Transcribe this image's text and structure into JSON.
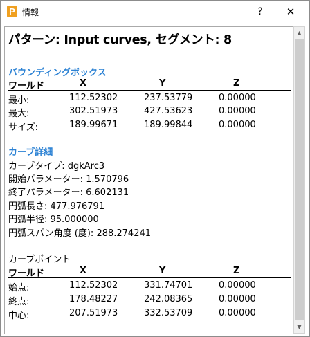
{
  "window": {
    "title": "情報",
    "icon_letter": "P",
    "help_label": "?",
    "close_label": "✕"
  },
  "heading": "パターン: Input curves, セグメント: 8",
  "bbox": {
    "section_title": "バウンディングボックス",
    "headers": [
      "ワールド",
      "X",
      "Y",
      "Z"
    ],
    "rows": [
      {
        "label": "最小:",
        "x": "112.52302",
        "y": "237.53779",
        "z": "0.00000"
      },
      {
        "label": "最大:",
        "x": "302.51973",
        "y": "427.53623",
        "z": "0.00000"
      },
      {
        "label": "サイズ:",
        "x": "189.99671",
        "y": "189.99844",
        "z": "0.00000"
      }
    ]
  },
  "curve": {
    "section_title": "カーブ詳細",
    "lines": [
      "カーブタイプ: dgkArc3",
      "開始パラメーター: 1.570796",
      "終了パラメーター: 6.602131",
      "円弧長さ: 477.976791",
      "円弧半径: 95.000000",
      "円弧スパン角度 (度): 288.274241"
    ]
  },
  "points": {
    "section_title": "カーブポイント",
    "headers": [
      "ワールド",
      "X",
      "Y",
      "Z"
    ],
    "rows": [
      {
        "label": "始点:",
        "x": "112.52302",
        "y": "331.74701",
        "z": "0.00000"
      },
      {
        "label": "終点:",
        "x": "178.48227",
        "y": "242.08365",
        "z": "0.00000"
      },
      {
        "label": "中心:",
        "x": "207.51973",
        "y": "332.53709",
        "z": "0.00000"
      }
    ]
  }
}
